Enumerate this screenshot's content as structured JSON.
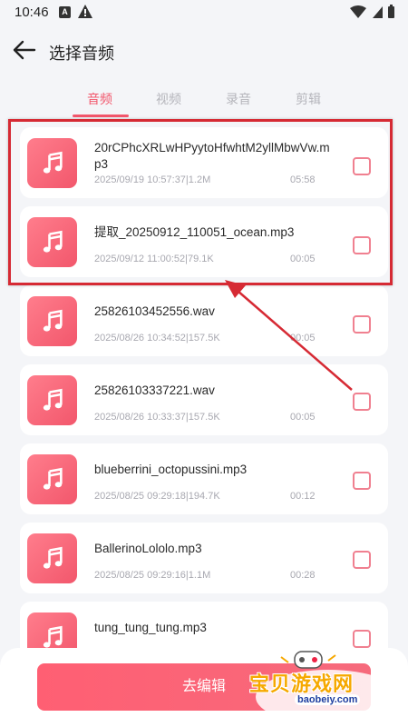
{
  "status": {
    "time": "10:46",
    "icon_a": "A"
  },
  "header": {
    "title": "选择音频"
  },
  "tabs": [
    {
      "label": "音频",
      "active": true
    },
    {
      "label": "视频",
      "active": false
    },
    {
      "label": "录音",
      "active": false
    },
    {
      "label": "剪辑",
      "active": false
    }
  ],
  "files": [
    {
      "name": "20rCPhcXRLwHPyytoHfwhtM2yllMbwVw.mp3",
      "meta": "2025/09/19 10:57:37|1.2M",
      "duration": "05:58"
    },
    {
      "name": "提取_20250912_110051_ocean.mp3",
      "meta": "2025/09/12 11:00:52|79.1K",
      "duration": "00:05"
    },
    {
      "name": "25826103452556.wav",
      "meta": "2025/08/26 10:34:52|157.5K",
      "duration": "00:05"
    },
    {
      "name": "25826103337221.wav",
      "meta": "2025/08/26 10:33:37|157.5K",
      "duration": "00:05"
    },
    {
      "name": "blueberrini_octopussini.mp3",
      "meta": "2025/08/25 09:29:18|194.7K",
      "duration": "00:12"
    },
    {
      "name": "BallerinoLololo.mp3",
      "meta": "2025/08/25 09:29:16|1.1M",
      "duration": "00:28"
    },
    {
      "name": "tung_tung_tung.mp3",
      "meta": "",
      "duration": ""
    }
  ],
  "actions": {
    "edit_label": "去编辑"
  },
  "watermark": {
    "text": "宝贝游戏网",
    "url": "baobeiy.com"
  },
  "colors": {
    "accent": "#f2576c",
    "highlight": "#d62a34"
  }
}
